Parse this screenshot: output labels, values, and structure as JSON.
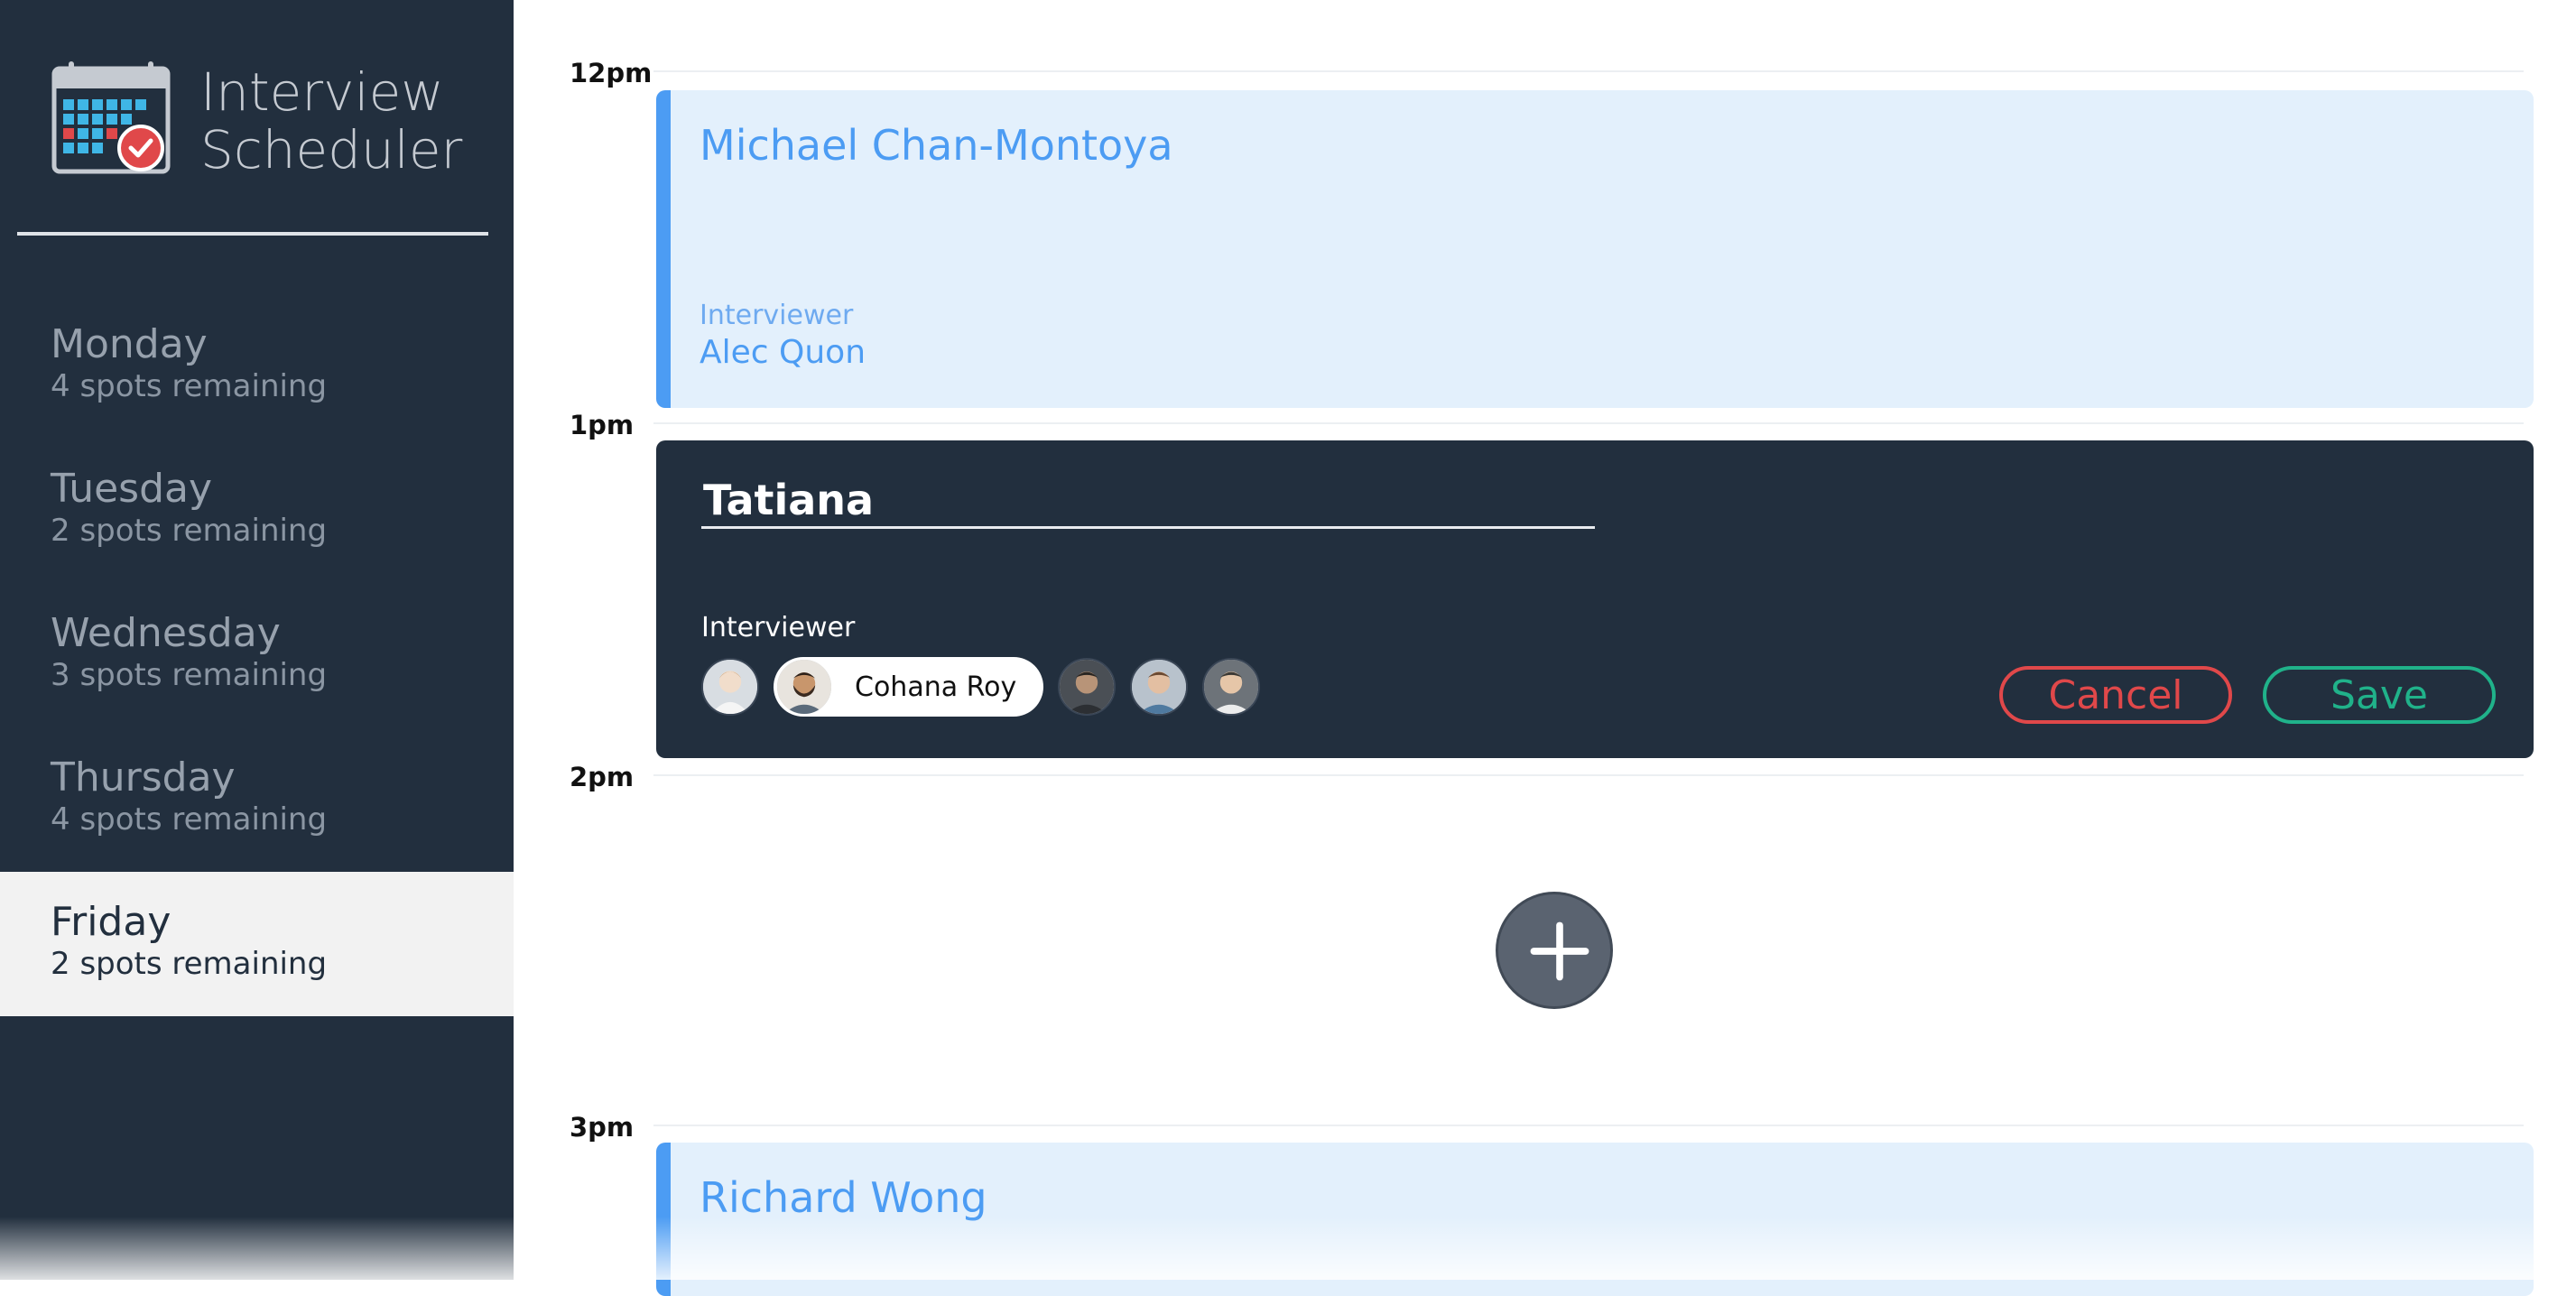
{
  "app": {
    "title_line1": "Interview",
    "title_line2": "Scheduler"
  },
  "sidebar": {
    "days": [
      {
        "name": "Monday",
        "spots": "4 spots remaining",
        "selected": false
      },
      {
        "name": "Tuesday",
        "spots": "2 spots remaining",
        "selected": false
      },
      {
        "name": "Wednesday",
        "spots": "3 spots remaining",
        "selected": false
      },
      {
        "name": "Thursday",
        "spots": "4 spots remaining",
        "selected": false
      },
      {
        "name": "Friday",
        "spots": "2 spots remaining",
        "selected": true
      }
    ]
  },
  "schedule": {
    "times": [
      "12pm",
      "1pm",
      "2pm",
      "3pm"
    ],
    "appointments": [
      {
        "student": "Michael Chan-Montoya",
        "interviewer_label": "Interviewer",
        "interviewer": "Alec Quon"
      },
      {
        "student": "Richard Wong"
      }
    ],
    "form": {
      "student_value": "Tatiana",
      "interviewer_label": "Interviewer",
      "selected_interviewer": "Cohana Roy",
      "cancel_label": "Cancel",
      "save_label": "Save"
    }
  },
  "colors": {
    "sidebar_bg": "#222f3e",
    "accent_blue": "#4c9cf3",
    "cancel_red": "#e0484a",
    "save_green": "#20b28a"
  },
  "icons": {
    "logo": "calendar-check-icon",
    "add": "plus-icon"
  }
}
